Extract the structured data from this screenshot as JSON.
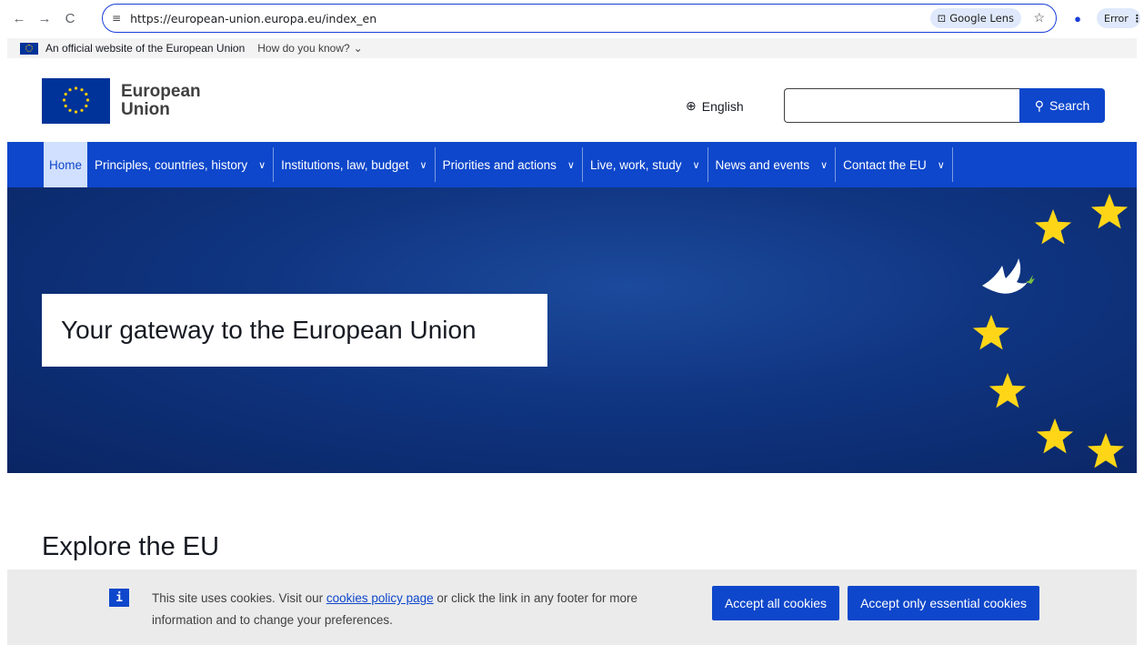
{
  "browser": {
    "back_icon": "←",
    "forward_icon": "→",
    "reload_icon": "C",
    "site_info_icon": "≡",
    "url": "https://european-union.europa.eu/index_en",
    "lens_label": "Google Lens",
    "lens_icon": "⊡",
    "star_icon": "☆",
    "profile_icon": "●",
    "error_label": "Error",
    "kebab_icon": "⋮"
  },
  "official_banner": {
    "text": "An official website of the European Union",
    "know_link": "How do you know?",
    "chevron": "⌄"
  },
  "header": {
    "logo_line1": "European",
    "logo_line2": "Union",
    "language_icon": "⊕",
    "language": "English",
    "search_placeholder": "",
    "search_label": "Search",
    "search_icon": "⚲"
  },
  "nav": {
    "home": "Home",
    "chevron": "∨",
    "items": [
      {
        "label": "Principles, countries, history"
      },
      {
        "label": "Institutions, law, budget"
      },
      {
        "label": "Priorities and actions"
      },
      {
        "label": "Live, work, study"
      },
      {
        "label": "News and events"
      },
      {
        "label": "Contact the EU"
      }
    ]
  },
  "hero": {
    "title": "Your gateway to the European Union",
    "dove_icon": "dove-icon",
    "star_color": "#ffd617",
    "bg_color": "#0f3480"
  },
  "explore": {
    "title": "Explore the EU"
  },
  "cookie": {
    "info_icon": "i",
    "text_before": "This site uses cookies. Visit our ",
    "link": "cookies policy page",
    "text_after": " or click the link in any footer for more information and to change your preferences.",
    "accept_all": "Accept all cookies",
    "accept_essential": "Accept only essential cookies"
  },
  "colors": {
    "primary": "#0e47cb",
    "home_bg": "#d1e0ff",
    "eu_blue": "#003399",
    "eu_yellow": "#ffcc00"
  }
}
